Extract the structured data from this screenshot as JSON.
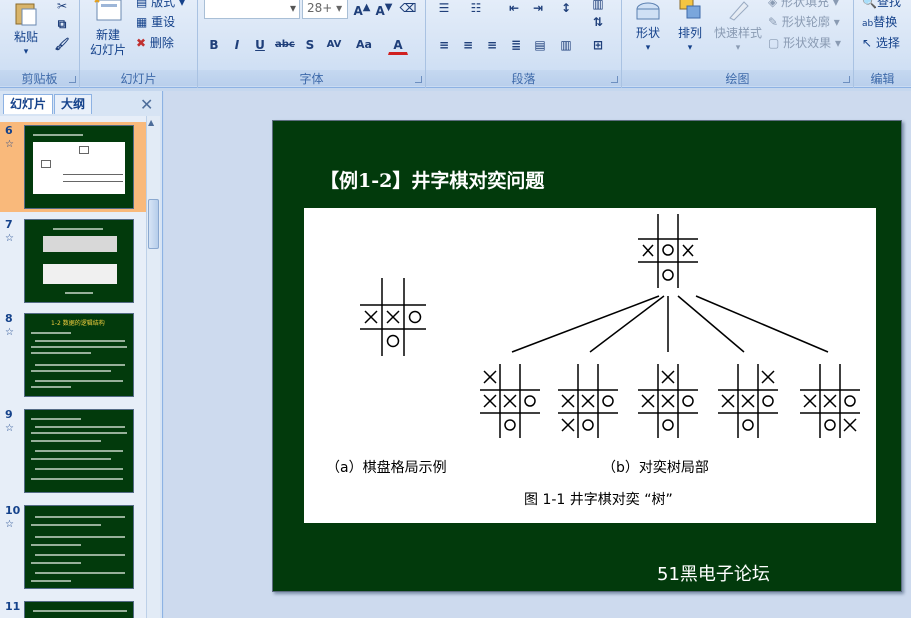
{
  "ribbon": {
    "clipboard": {
      "label": "剪贴板",
      "paste": "粘贴"
    },
    "slides": {
      "label": "幻灯片",
      "new_slide": "新建",
      "new_slide2": "幻灯片",
      "layout": "版式",
      "reset": "重设",
      "delete": "删除"
    },
    "font": {
      "label": "字体",
      "size": "28+"
    },
    "paragraph": {
      "label": "段落"
    },
    "drawing": {
      "label": "绘图",
      "shape": "形状",
      "arrange": "排列",
      "quick_styles": "快速样式",
      "shape_fill": "形状填充",
      "shape_outline": "形状轮廓",
      "shape_effects": "形状效果"
    },
    "editing": {
      "label": "编辑",
      "find": "查找",
      "replace": "替换",
      "select": "选择"
    }
  },
  "panel": {
    "tab_slides": "幻灯片",
    "tab_outline": "大纲",
    "close": "✕",
    "thumbnails": [
      {
        "num": "6",
        "selected": true
      },
      {
        "num": "7",
        "selected": false
      },
      {
        "num": "8",
        "selected": false,
        "title": "1-2 数据的逻辑结构"
      },
      {
        "num": "9",
        "selected": false
      },
      {
        "num": "10",
        "selected": false
      },
      {
        "num": "11",
        "selected": false
      }
    ]
  },
  "slide": {
    "title": "【例1-2】井字棋对奕问题",
    "fig_caption_a": "（a）棋盘格局示例",
    "fig_caption_b": "（b）对奕树局部",
    "fig_title": "图 1-1  井字棋对奕 “树”",
    "watermark": "51黑电子论坛"
  }
}
